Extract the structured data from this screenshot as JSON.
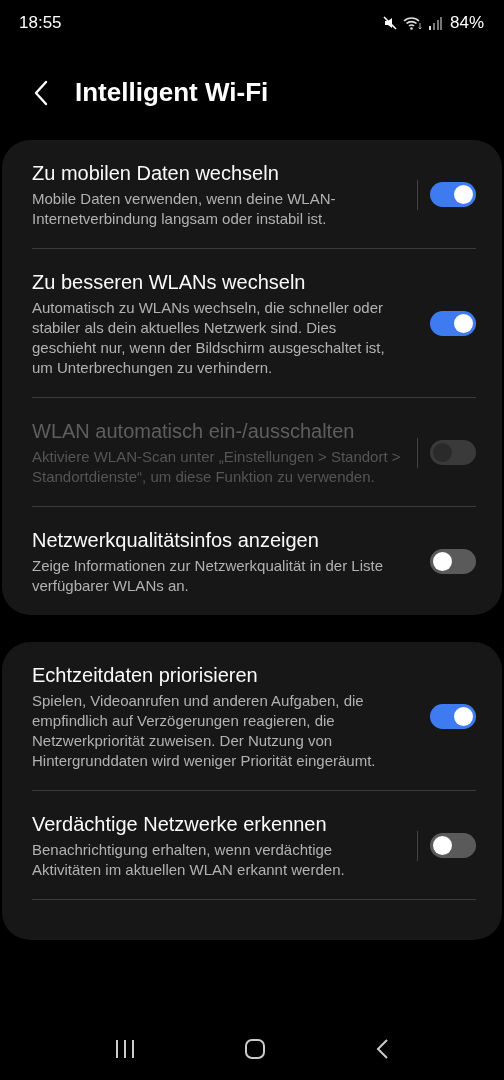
{
  "status_bar": {
    "time": "18:55",
    "battery": "84%"
  },
  "header": {
    "title": "Intelligent Wi-Fi"
  },
  "groups": [
    {
      "items": [
        {
          "title": "Zu mobilen Daten wechseln",
          "description": "Mobile Daten verwenden, wenn deine WLAN-Internetverbindung langsam oder instabil ist.",
          "on": true,
          "disabled": false,
          "divider": true
        },
        {
          "title": "Zu besseren WLANs wechseln",
          "description": "Automatisch zu WLANs wechseln, die schneller oder stabiler als dein aktuelles Netzwerk sind. Dies geschieht nur, wenn der Bildschirm ausgeschaltet ist, um Unterbrechungen zu verhindern.",
          "on": true,
          "disabled": false,
          "divider": false
        },
        {
          "title": "WLAN automatisch ein-/ausschalten",
          "description": "Aktiviere WLAN-Scan unter „Einstellungen > Standort > Standortdienste“, um diese Funktion zu verwenden.",
          "on": false,
          "disabled": true,
          "divider": true
        },
        {
          "title": "Netzwerkqualitätsinfos anzeigen",
          "description": "Zeige Informationen zur Netzwerkqualität in der Liste verfügbarer WLANs an.",
          "on": false,
          "disabled": false,
          "divider": false
        }
      ]
    },
    {
      "items": [
        {
          "title": "Echtzeitdaten priorisieren",
          "description": "Spielen, Videoanrufen und anderen Aufgaben, die empfindlich auf Verzögerungen reagieren, die Netzwerkpriorität zuweisen. Der Nutzung von Hintergrunddaten wird weniger Priorität eingeräumt.",
          "on": true,
          "disabled": false,
          "divider": false
        },
        {
          "title": "Verdächtige Netzwerke erkennen",
          "description": "Benachrichtigung erhalten, wenn verdächtige Aktivitäten im aktuellen WLAN erkannt werden.",
          "on": false,
          "disabled": false,
          "divider": true
        }
      ]
    }
  ]
}
